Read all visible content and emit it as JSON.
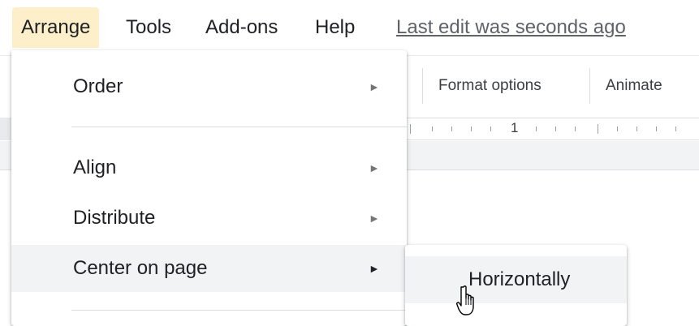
{
  "menubar": {
    "items": [
      {
        "label": "Arrange",
        "active": true
      },
      {
        "label": "Tools",
        "active": false
      },
      {
        "label": "Add-ons",
        "active": false
      },
      {
        "label": "Help",
        "active": false
      }
    ],
    "last_edit": "Last edit was seconds ago"
  },
  "toolbar": {
    "format_options": "Format options",
    "animate": "Animate"
  },
  "ruler": {
    "label": "1"
  },
  "arrange_menu": {
    "items": [
      {
        "label": "Order",
        "has_submenu": true,
        "arrow": "►"
      },
      {
        "label": "Align",
        "has_submenu": true,
        "arrow": "►"
      },
      {
        "label": "Distribute",
        "has_submenu": true,
        "arrow": "►"
      },
      {
        "label": "Center on page",
        "has_submenu": true,
        "arrow": "►",
        "highlighted": true
      }
    ]
  },
  "center_submenu": {
    "items": [
      {
        "label": "Horizontally",
        "highlighted": true
      }
    ]
  },
  "cursor": {
    "icon": "hand-pointer-icon"
  },
  "colors": {
    "active_menu_bg": "#fcefc9",
    "hover_bg": "#f1f3f4",
    "text": "#202124",
    "secondary_text": "#5f6368"
  }
}
